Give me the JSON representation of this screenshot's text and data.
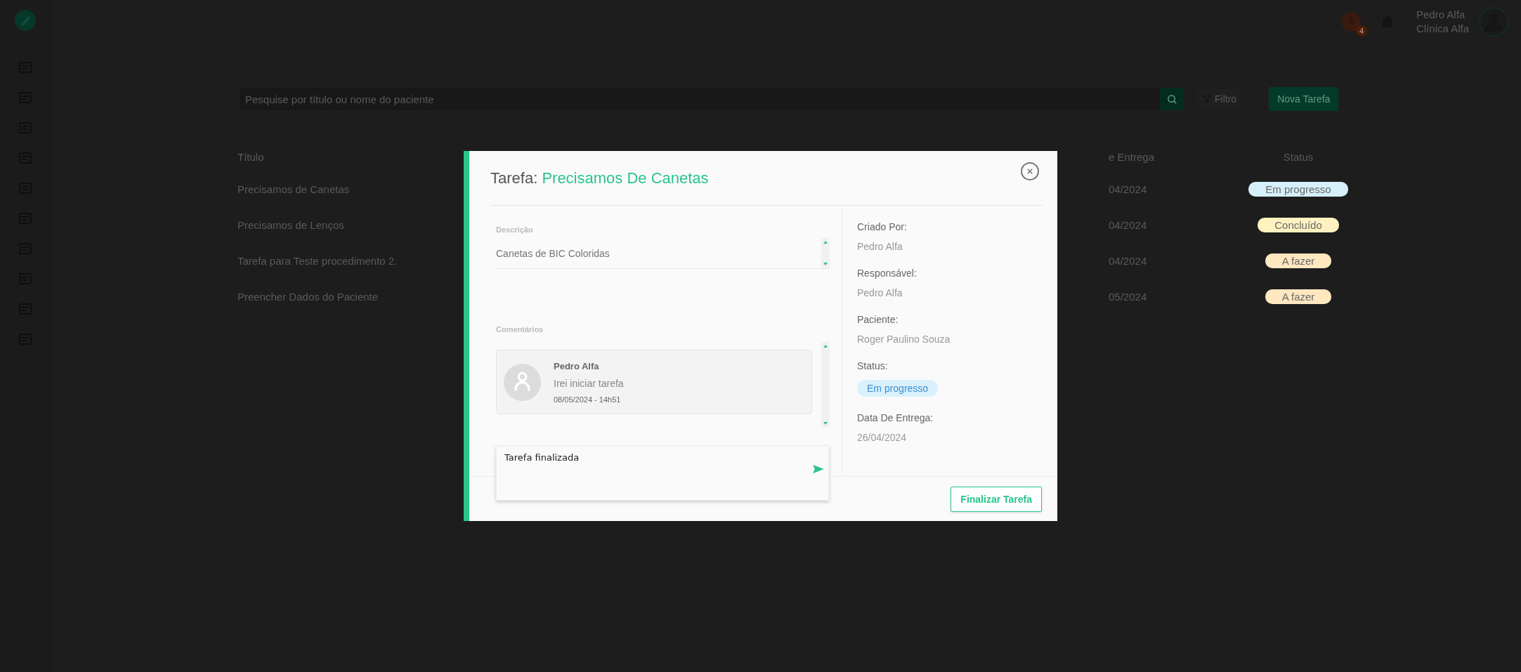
{
  "header": {
    "notification_count": "4",
    "user_name": "Pedro Alfa",
    "clinic": "Clínica Alfa"
  },
  "toolbar": {
    "search": {
      "placeholder": "Pesquise por título ou nome do paciente"
    },
    "filter_label": "Filtro",
    "new_button": "Nova Tarefa"
  },
  "table": {
    "columns": [
      "Título",
      "e Entrega",
      "Status"
    ],
    "rows": [
      {
        "title": "Precisamos de Canetas",
        "date": "04/2024",
        "status": "Em progresso",
        "color": "#d6f0fb"
      },
      {
        "title": "Precisamos de Lenços",
        "date": "04/2024",
        "status": "Concluído",
        "color": "#fff2c0"
      },
      {
        "title": "Tarefa para Teste procedimento 2.",
        "date": "04/2024",
        "status": "A fazer",
        "color": "#ffe7c0"
      },
      {
        "title": "Preencher Dados do Paciente",
        "date": "05/2024",
        "status": "A fazer",
        "color": "#ffe7c0"
      }
    ]
  },
  "modal": {
    "title_prefix": "Tarefa:",
    "title": "Precisamos De Canetas",
    "description_label": "Descrição",
    "description": "Canetas de BIC Coloridas",
    "comments_label": "Comentários",
    "comments": [
      {
        "author": "Pedro Alfa",
        "text": "Irei iniciar tarefa",
        "time": "08/05/2024 - 14h51"
      }
    ],
    "comment_input": "Tarefa finalizada",
    "details": [
      {
        "kind": "text",
        "label": "Criado Por:",
        "value": "Pedro Alfa"
      },
      {
        "kind": "text",
        "label": "Responsável:",
        "value": "Pedro Alfa"
      },
      {
        "kind": "text",
        "label": "Paciente:",
        "value": "Roger Paulino Souza"
      },
      {
        "kind": "badge",
        "label": "Status:",
        "value": "Em progresso",
        "color": "#daf1fd"
      },
      {
        "kind": "text",
        "label": "Data De Entrega:",
        "value": "26/04/2024"
      }
    ],
    "finish_button": "Finalizar Tarefa"
  }
}
